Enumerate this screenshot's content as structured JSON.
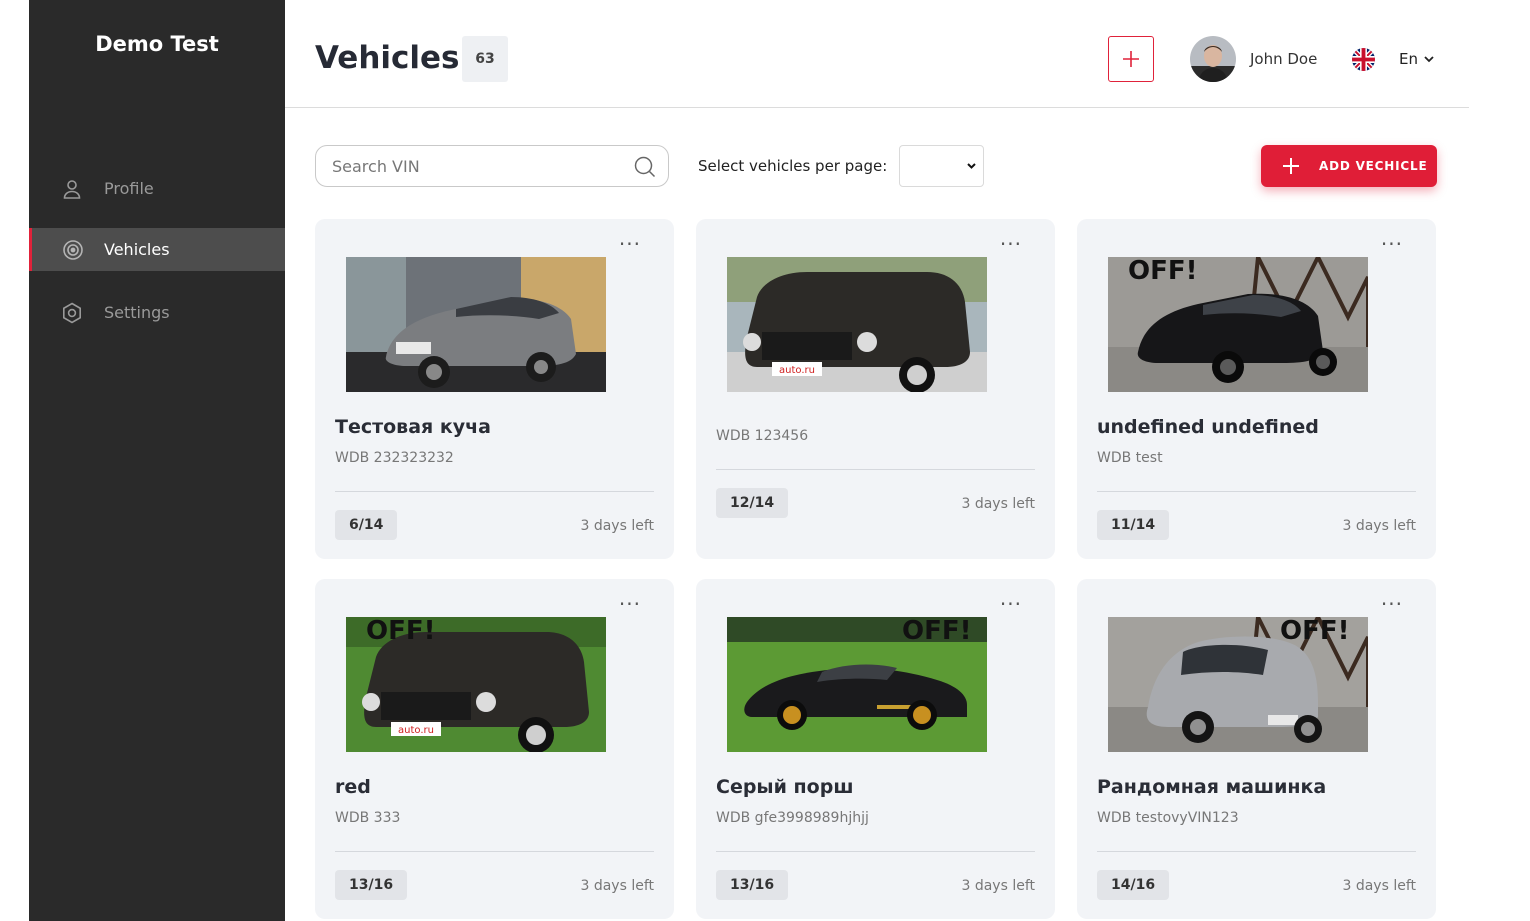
{
  "app": {
    "brand": "Demo Test"
  },
  "sidebar": {
    "items": [
      {
        "label": "Profile",
        "icon": "user-icon"
      },
      {
        "label": "Vehicles",
        "icon": "target-icon",
        "active": true
      },
      {
        "label": "Settings",
        "icon": "gear-icon"
      }
    ]
  },
  "header": {
    "title": "Vehicles",
    "count": "63",
    "user_name": "John Doe",
    "language": "En"
  },
  "toolbar": {
    "search_placeholder": "Search VIN",
    "per_page_label": "Select vehicles per page:",
    "per_page_value": "",
    "add_label": "ADD VECHICLE"
  },
  "colors": {
    "accent": "#e01e37",
    "sidebar": "#2a2a2a",
    "card": "#f2f4f7"
  },
  "vehicles": [
    {
      "name": "Тестовая куча",
      "vin": "WDB 232323232",
      "progress": "6/14",
      "days": "3 days left",
      "photo": "grey-hatchback-showroom"
    },
    {
      "name": "",
      "vin": "WDB 123456",
      "progress": "12/14",
      "days": "3 days left",
      "photo": "black-offroad-outdoor"
    },
    {
      "name": "undefined undefined",
      "vin": "WDB test",
      "progress": "11/14",
      "days": "3 days left",
      "photo": "black-hatchback-off-banner",
      "photo_text": "OFF!"
    },
    {
      "name": "red",
      "vin": "WDB 333",
      "progress": "13/16",
      "days": "3 days left",
      "photo": "black-offroad-on-grass",
      "photo_text": "OFF!"
    },
    {
      "name": "Серый порш",
      "vin": "WDB gfe3998989hjhjj",
      "progress": "13/16",
      "days": "3 days left",
      "photo": "black-sportscar-on-grass",
      "photo_text": "OFF!"
    },
    {
      "name": "Рандомная машинка",
      "vin": "WDB testovyVIN123",
      "progress": "14/16",
      "days": "3 days left",
      "photo": "silver-hatchback-off-banner",
      "photo_text": "OFF!"
    }
  ]
}
